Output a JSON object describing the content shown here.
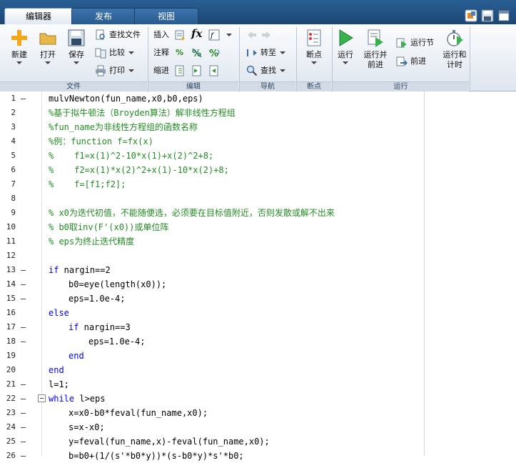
{
  "tabs": [
    {
      "label": "编辑器",
      "active": true
    },
    {
      "label": "发布",
      "active": false
    },
    {
      "label": "视图",
      "active": false
    }
  ],
  "quick_access": [
    "app-icon",
    "save-icon",
    "window-icon"
  ],
  "ribbon": {
    "file_group": {
      "label": "文件",
      "new_label": "新建",
      "open_label": "打开",
      "save_label": "保存",
      "find_file_label": "查找文件",
      "compare_label": "比较",
      "print_label": "打印"
    },
    "edit_group": {
      "label": "编辑",
      "insert_label": "插入",
      "comment_label": "注释",
      "indent_label": "缩进",
      "fx_label": "fx"
    },
    "nav_group": {
      "label": "导航",
      "goto_label": "转至",
      "find_label": "查找"
    },
    "breakpoint_group": {
      "label": "断点",
      "breakpoint_label": "断点"
    },
    "run_group": {
      "label": "运行",
      "run_label": "运行",
      "run_advance_label_1": "运行并",
      "run_advance_label_2": "前进",
      "run_section_label": "运行节",
      "advance_label": "前进",
      "run_time_label_1": "运行和",
      "run_time_label_2": "计时"
    }
  },
  "colors": {
    "keyword": "#0000ff",
    "comment": "#228b22",
    "tabbar": "#1b4674"
  },
  "code_lines": [
    {
      "n": "1",
      "dash": "—",
      "text": "mulvNewton(fun_name,x0,b0,eps)",
      "type": "code",
      "indent": 0
    },
    {
      "n": "2",
      "dash": "",
      "text": "%基于拟牛顿法（Broyden算法）解非线性方程组",
      "type": "comment",
      "indent": 0
    },
    {
      "n": "3",
      "dash": "",
      "text": "%fun_name为非线性方程组的函数名称",
      "type": "comment",
      "indent": 0
    },
    {
      "n": "4",
      "dash": "",
      "text": "%例：function f=fx(x)",
      "type": "comment",
      "indent": 0
    },
    {
      "n": "5",
      "dash": "",
      "text": "%    f1=x(1)^2-10*x(1)+x(2)^2+8;",
      "type": "comment",
      "indent": 0
    },
    {
      "n": "6",
      "dash": "",
      "text": "%    f2=x(1)*x(2)^2+x(1)-10*x(2)+8;",
      "type": "comment",
      "indent": 0
    },
    {
      "n": "7",
      "dash": "",
      "text": "%    f=[f1;f2];",
      "type": "comment",
      "indent": 0
    },
    {
      "n": "8",
      "dash": "",
      "text": "",
      "type": "code",
      "indent": 0
    },
    {
      "n": "9",
      "dash": "",
      "text": "% x0为迭代初值，不能随便选，必须要在目标值附近，否则发散或解不出来",
      "type": "comment",
      "indent": 0
    },
    {
      "n": "10",
      "dash": "",
      "text": "% b0取inv(F'(x0))或单位阵",
      "type": "comment",
      "indent": 0
    },
    {
      "n": "11",
      "dash": "",
      "text": "% eps为终止迭代精度",
      "type": "comment",
      "indent": 0
    },
    {
      "n": "12",
      "dash": "",
      "text": "",
      "type": "code",
      "indent": 0
    },
    {
      "n": "13",
      "dash": "—",
      "text": "nargin==2",
      "kw": "if",
      "type": "kwline",
      "indent": 0
    },
    {
      "n": "14",
      "dash": "—",
      "text": "b0=eye(length(x0));",
      "type": "code",
      "indent": 1
    },
    {
      "n": "15",
      "dash": "—",
      "text": "eps=1.0e-4;",
      "type": "code",
      "indent": 1
    },
    {
      "n": "16",
      "dash": "",
      "text": "",
      "kw": "else",
      "type": "kwline",
      "indent": 0
    },
    {
      "n": "17",
      "dash": "—",
      "text": "nargin==3",
      "kw": "if",
      "type": "kwline",
      "indent": 1
    },
    {
      "n": "18",
      "dash": "—",
      "text": "eps=1.0e-4;",
      "type": "code",
      "indent": 2
    },
    {
      "n": "19",
      "dash": "",
      "text": "",
      "kw": "end",
      "type": "kwline",
      "indent": 1
    },
    {
      "n": "20",
      "dash": "",
      "text": "",
      "kw": "end",
      "type": "kwline",
      "indent": 0
    },
    {
      "n": "21",
      "dash": "—",
      "text": "l=1;",
      "type": "code",
      "indent": 0
    },
    {
      "n": "22",
      "dash": "—",
      "text": "l>eps",
      "kw": "while",
      "type": "kwline",
      "indent": 0,
      "fold": true
    },
    {
      "n": "23",
      "dash": "—",
      "text": "x=x0-b0*feval(fun_name,x0);",
      "type": "code",
      "indent": 1
    },
    {
      "n": "24",
      "dash": "—",
      "text": "s=x-x0;",
      "type": "code",
      "indent": 1
    },
    {
      "n": "25",
      "dash": "—",
      "text": "y=feval(fun_name,x)-feval(fun_name,x0);",
      "type": "code",
      "indent": 1
    },
    {
      "n": "26",
      "dash": "—",
      "text": "b=b0+(1/(s'*b0*y))*(s-b0*y)*s'*b0;",
      "type": "code",
      "indent": 1
    }
  ]
}
